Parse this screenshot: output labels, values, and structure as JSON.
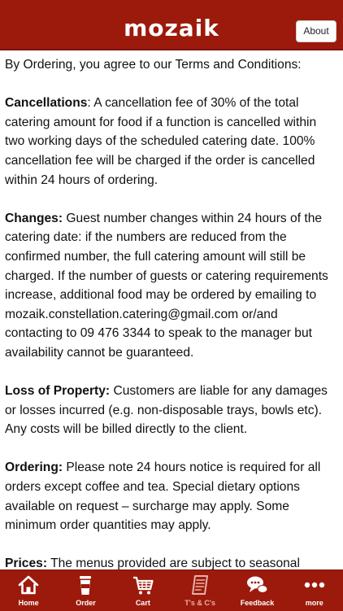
{
  "header": {
    "logo": "mozaik",
    "about_label": "About"
  },
  "content": {
    "intro": "By Ordering, you agree to our Terms and Conditions:",
    "sections": [
      {
        "heading": "Cancellations",
        "sep": ": ",
        "body": "A cancellation fee of 30% of the total catering amount for food if a function is cancelled within two working days of the scheduled catering date. 100% cancellation fee will be charged if the order is cancelled within 24 hours of ordering."
      },
      {
        "heading": "Changes:",
        "sep": " ",
        "body": "Guest number changes within 24 hours of the catering date: if the numbers are reduced from the confirmed number, the full catering amount will still be charged. If the number of guests or catering requirements increase, additional food may be ordered by emailing to mozaik.constellation.catering@gmail.com or/and contacting to 09 476 3344 to speak to the manager but availability cannot be guaranteed."
      },
      {
        "heading": "Loss of Property:",
        "sep": " ",
        "body": "Customers are liable for any damages or losses incurred (e.g. non-disposable trays, bowls etc). Any costs will be billed directly to the client."
      },
      {
        "heading": "Ordering:",
        "sep": " ",
        "body": "Please note 24 hours notice is required for all orders except coffee and tea. Special dietary options available on request – surcharge may apply. Some minimum order quantities may apply."
      },
      {
        "heading": "Prices:",
        "sep": " ",
        "body": "The menus provided are subject to seasonal"
      }
    ]
  },
  "tabbar": {
    "tabs": [
      {
        "label": "Home",
        "icon": "home-icon"
      },
      {
        "label": "Order",
        "icon": "coffee-cup-icon"
      },
      {
        "label": "Cart",
        "icon": "cart-icon"
      },
      {
        "label": "T's & C's",
        "icon": "document-icon"
      },
      {
        "label": "Feedback",
        "icon": "chat-icon"
      },
      {
        "label": "more",
        "icon": "more-icon"
      }
    ],
    "active_index": 3
  },
  "colors": {
    "brand": "#9c1a0c",
    "active_tab": "#e6b1aa",
    "text": "#111111"
  }
}
